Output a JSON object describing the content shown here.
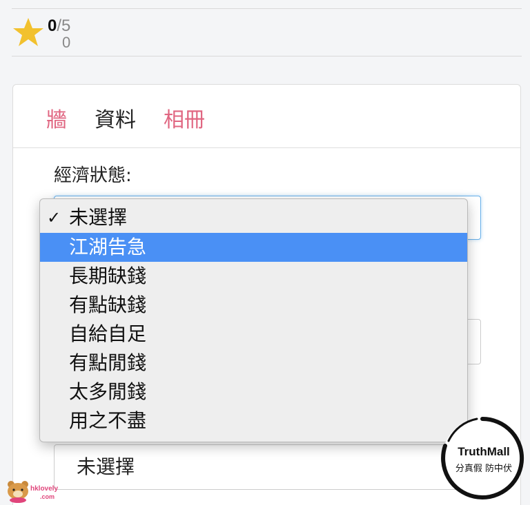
{
  "rating": {
    "current": "0",
    "separator": "/",
    "max": "5",
    "count": "0"
  },
  "tabs": [
    {
      "label": "牆"
    },
    {
      "label": "資料"
    },
    {
      "label": "相冊"
    }
  ],
  "form": {
    "economic_status_label": "經濟狀態:",
    "second_select_value": "未選擇"
  },
  "dropdown": {
    "checkmark": "✓",
    "options": [
      {
        "label": "未選擇"
      },
      {
        "label": "江湖告急"
      },
      {
        "label": "長期缺錢"
      },
      {
        "label": "有點缺錢"
      },
      {
        "label": "自給自足"
      },
      {
        "label": "有點閒錢"
      },
      {
        "label": "太多閒錢"
      },
      {
        "label": "用之不盡"
      }
    ]
  },
  "watermarks": {
    "bear_line1": "hklovely",
    "bear_line2": ".com",
    "badge_title": "TruthMall",
    "badge_subtitle": "分真假 防中伏"
  },
  "colors": {
    "accent_pink": "#e06681",
    "highlight_blue": "#4a90f5",
    "star_gold": "#f2c12e"
  }
}
